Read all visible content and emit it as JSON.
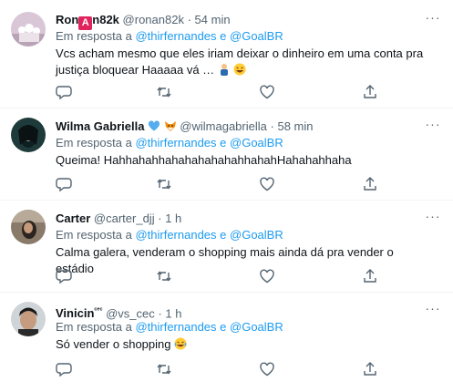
{
  "tweets": [
    {
      "name_pre": "Ron",
      "name_badge": "A",
      "name_post": "n82k",
      "handle": "@ronan82k",
      "time": "54 min",
      "reply_prefix": "Em resposta a",
      "mention1": "@thirfernandes",
      "conj": "e",
      "mention2": "@GoalBR",
      "text": "Vcs acham mesmo que eles iriam deixar o dinheiro em uma conta pra justiça bloquear Haaaaa vá …",
      "more": "···"
    },
    {
      "name": "Wilma Gabriella",
      "handle": "@wilmagabriella",
      "time": "58 min",
      "reply_prefix": "Em resposta a",
      "mention1": "@thirfernandes",
      "conj": "e",
      "mention2": "@GoalBR",
      "text": "Queima! HahhahahhahahahahahahhahahHahahahhaha",
      "more": "···"
    },
    {
      "name": "Carter",
      "handle": "@carter_djj",
      "time": "1 h",
      "reply_prefix": "Em resposta a",
      "mention1": "@thirfernandes",
      "conj": "e",
      "mention2": "@GoalBR",
      "text": "Calma galera, venderam o shopping mais ainda dá pra vender o estádio",
      "more": "···"
    },
    {
      "name": "Vinicin",
      "name_sup": "ᶜᵉᶜ",
      "handle": "@vs_cec",
      "time": "1 h",
      "reply_prefix": "Em resposta a",
      "mention1": "@thirfernandes",
      "conj": "e",
      "mention2": "@GoalBR",
      "text": "Só vender o shopping",
      "more": "···"
    }
  ],
  "separator": "·",
  "icons": [
    "reply-icon",
    "retweet-icon",
    "like-icon",
    "share-icon",
    "more-icon",
    "blue-heart-icon",
    "fox-icon",
    "man-icon",
    "laughing-emoji-icon",
    "tears-of-joy-emoji-icon"
  ],
  "colors": {
    "link": "#1d9bf0",
    "muted": "#536471",
    "text": "#0f1419",
    "border": "#eff3f4"
  }
}
